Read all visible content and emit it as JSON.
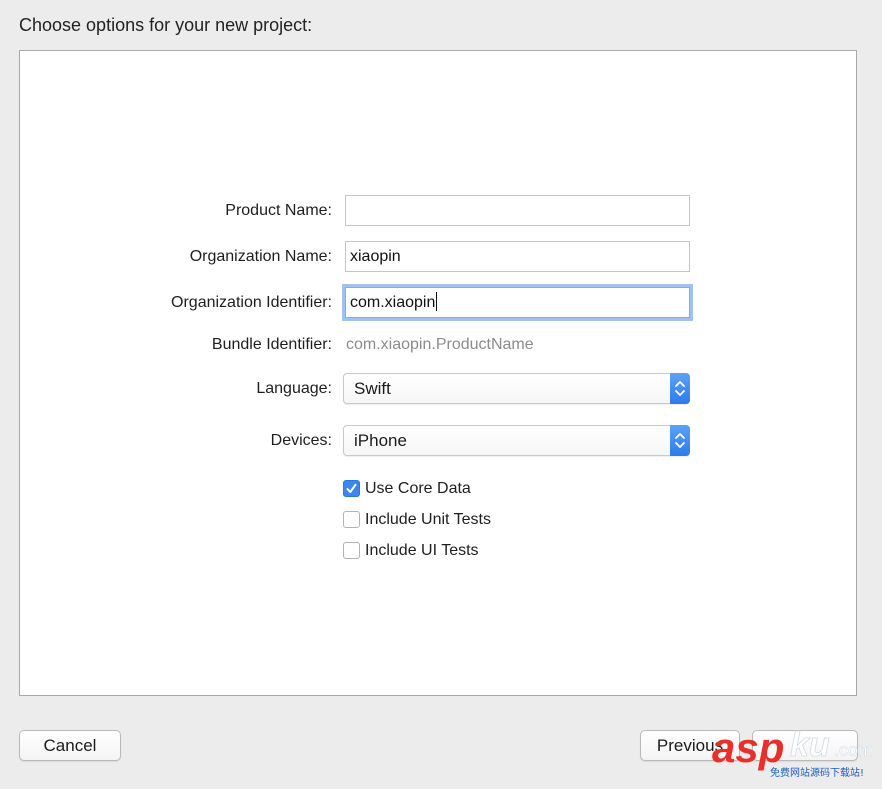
{
  "dialog": {
    "heading": "Choose options for your new project:"
  },
  "form": {
    "product_name": {
      "label": "Product Name:",
      "value": ""
    },
    "organization_name": {
      "label": "Organization Name:",
      "value": "xiaopin"
    },
    "organization_identifier": {
      "label": "Organization Identifier:",
      "value": "com.xiaopin"
    },
    "bundle_identifier": {
      "label": "Bundle Identifier:",
      "value": "com.xiaopin.ProductName"
    },
    "language": {
      "label": "Language:",
      "selected": "Swift"
    },
    "devices": {
      "label": "Devices:",
      "selected": "iPhone"
    },
    "checkboxes": [
      {
        "label": "Use Core Data",
        "checked": true
      },
      {
        "label": "Include Unit Tests",
        "checked": false
      },
      {
        "label": "Include UI Tests",
        "checked": false
      }
    ]
  },
  "footer": {
    "cancel_label": "Cancel",
    "previous_label": "Previous"
  },
  "watermark": {
    "brand": "asp",
    "brand_suffix": "ku",
    "domain": ".com",
    "tagline": "免费网站源码下载站!"
  },
  "colors": {
    "accent": "#3b86ef",
    "focus_ring": "#9ec3f2",
    "watermark_red": "#e8302a",
    "watermark_blue": "#1c5fb8"
  },
  "icons": {
    "select_arrows": "up-down-chevron-icon",
    "checkmark": "checkmark-icon"
  }
}
